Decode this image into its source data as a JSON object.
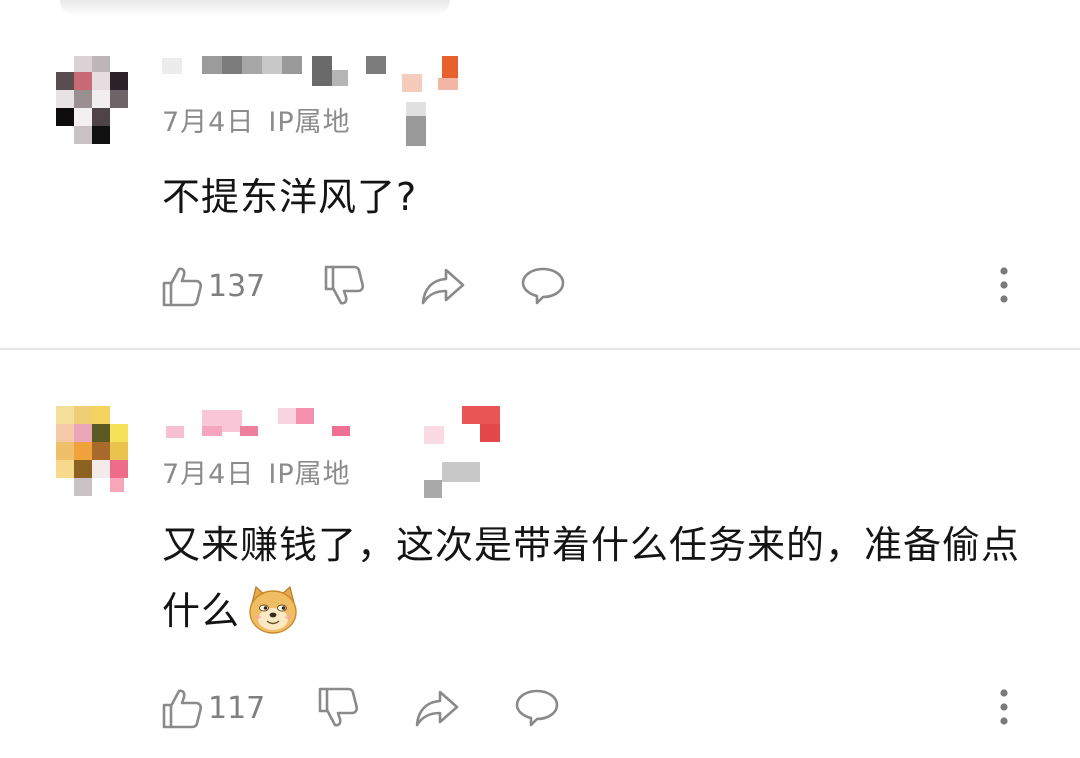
{
  "comments": [
    {
      "meta": {
        "date": "7月4日",
        "ip_label": "IP属地"
      },
      "text": "不提东洋风了?",
      "likes": "137"
    },
    {
      "meta": {
        "date": "7月4日",
        "ip_label": "IP属地"
      },
      "text": "又来赚钱了，这次是带着什么任务来的，准备偷点什么",
      "likes": "117"
    }
  ],
  "icons": {
    "like": "thumbs-up-icon",
    "dislike": "thumbs-down-icon",
    "share": "share-arrow-icon",
    "reply": "speech-bubble-icon",
    "more": "more-vertical-icon",
    "emoji": "doge-emoji-icon"
  },
  "colors": {
    "text": "#141414",
    "meta": "#8c8c8c",
    "icon": "#8a8a8a",
    "divider": "#e6e6e6"
  }
}
